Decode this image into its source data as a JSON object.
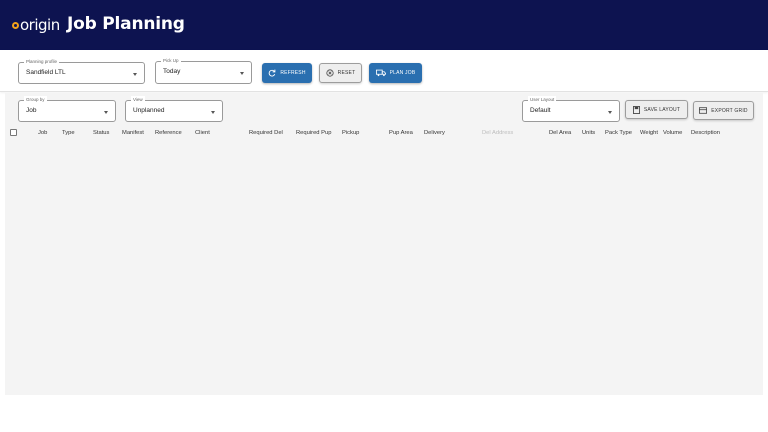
{
  "app": {
    "logo_text": "origin",
    "page_title": "Job Planning"
  },
  "colors": {
    "header_bg": "#0d1350",
    "logo_accent": "#f2a21b",
    "primary_button": "#2a6fb0",
    "grid_bg": "#f4f4f4"
  },
  "toolbar": {
    "planning_profile": {
      "label": "Planning profile",
      "value": "Sandfield LTL"
    },
    "pickup": {
      "label": "Pick Up",
      "value": "Today"
    },
    "refresh_label": "REFRESH",
    "reset_label": "RESET",
    "plan_job_label": "PLAN JOB"
  },
  "grid_controls": {
    "group_by": {
      "label": "Group by",
      "value": "Job"
    },
    "view": {
      "label": "View",
      "value": "Unplanned"
    },
    "user_layout": {
      "label": "User Layout",
      "value": "Default"
    },
    "save_layout_label": "SAVE LAYOUT",
    "export_grid_label": "EXPORT GRID"
  },
  "columns": [
    {
      "key": "job",
      "label": "Job"
    },
    {
      "key": "type",
      "label": "Type"
    },
    {
      "key": "status",
      "label": "Status"
    },
    {
      "key": "manifest",
      "label": "Manifest"
    },
    {
      "key": "reference",
      "label": "Reference"
    },
    {
      "key": "client",
      "label": "Client"
    },
    {
      "key": "required_del",
      "label": "Required Del"
    },
    {
      "key": "required_pup",
      "label": "Required Pup"
    },
    {
      "key": "pickup",
      "label": "Pickup"
    },
    {
      "key": "pup_area",
      "label": "Pup Area"
    },
    {
      "key": "delivery",
      "label": "Delivery"
    },
    {
      "key": "del_address",
      "label": "Del Address"
    },
    {
      "key": "del_area",
      "label": "Del Area"
    },
    {
      "key": "units",
      "label": "Units"
    },
    {
      "key": "pack_type",
      "label": "Pack Type"
    },
    {
      "key": "weight",
      "label": "Weight"
    },
    {
      "key": "volume",
      "label": "Volume"
    },
    {
      "key": "description",
      "label": "Description"
    }
  ],
  "icons": {
    "refresh": "refresh-icon",
    "reset": "reset-icon",
    "plan_job": "truck-icon",
    "save_layout": "save-icon",
    "export_grid": "export-icon"
  }
}
